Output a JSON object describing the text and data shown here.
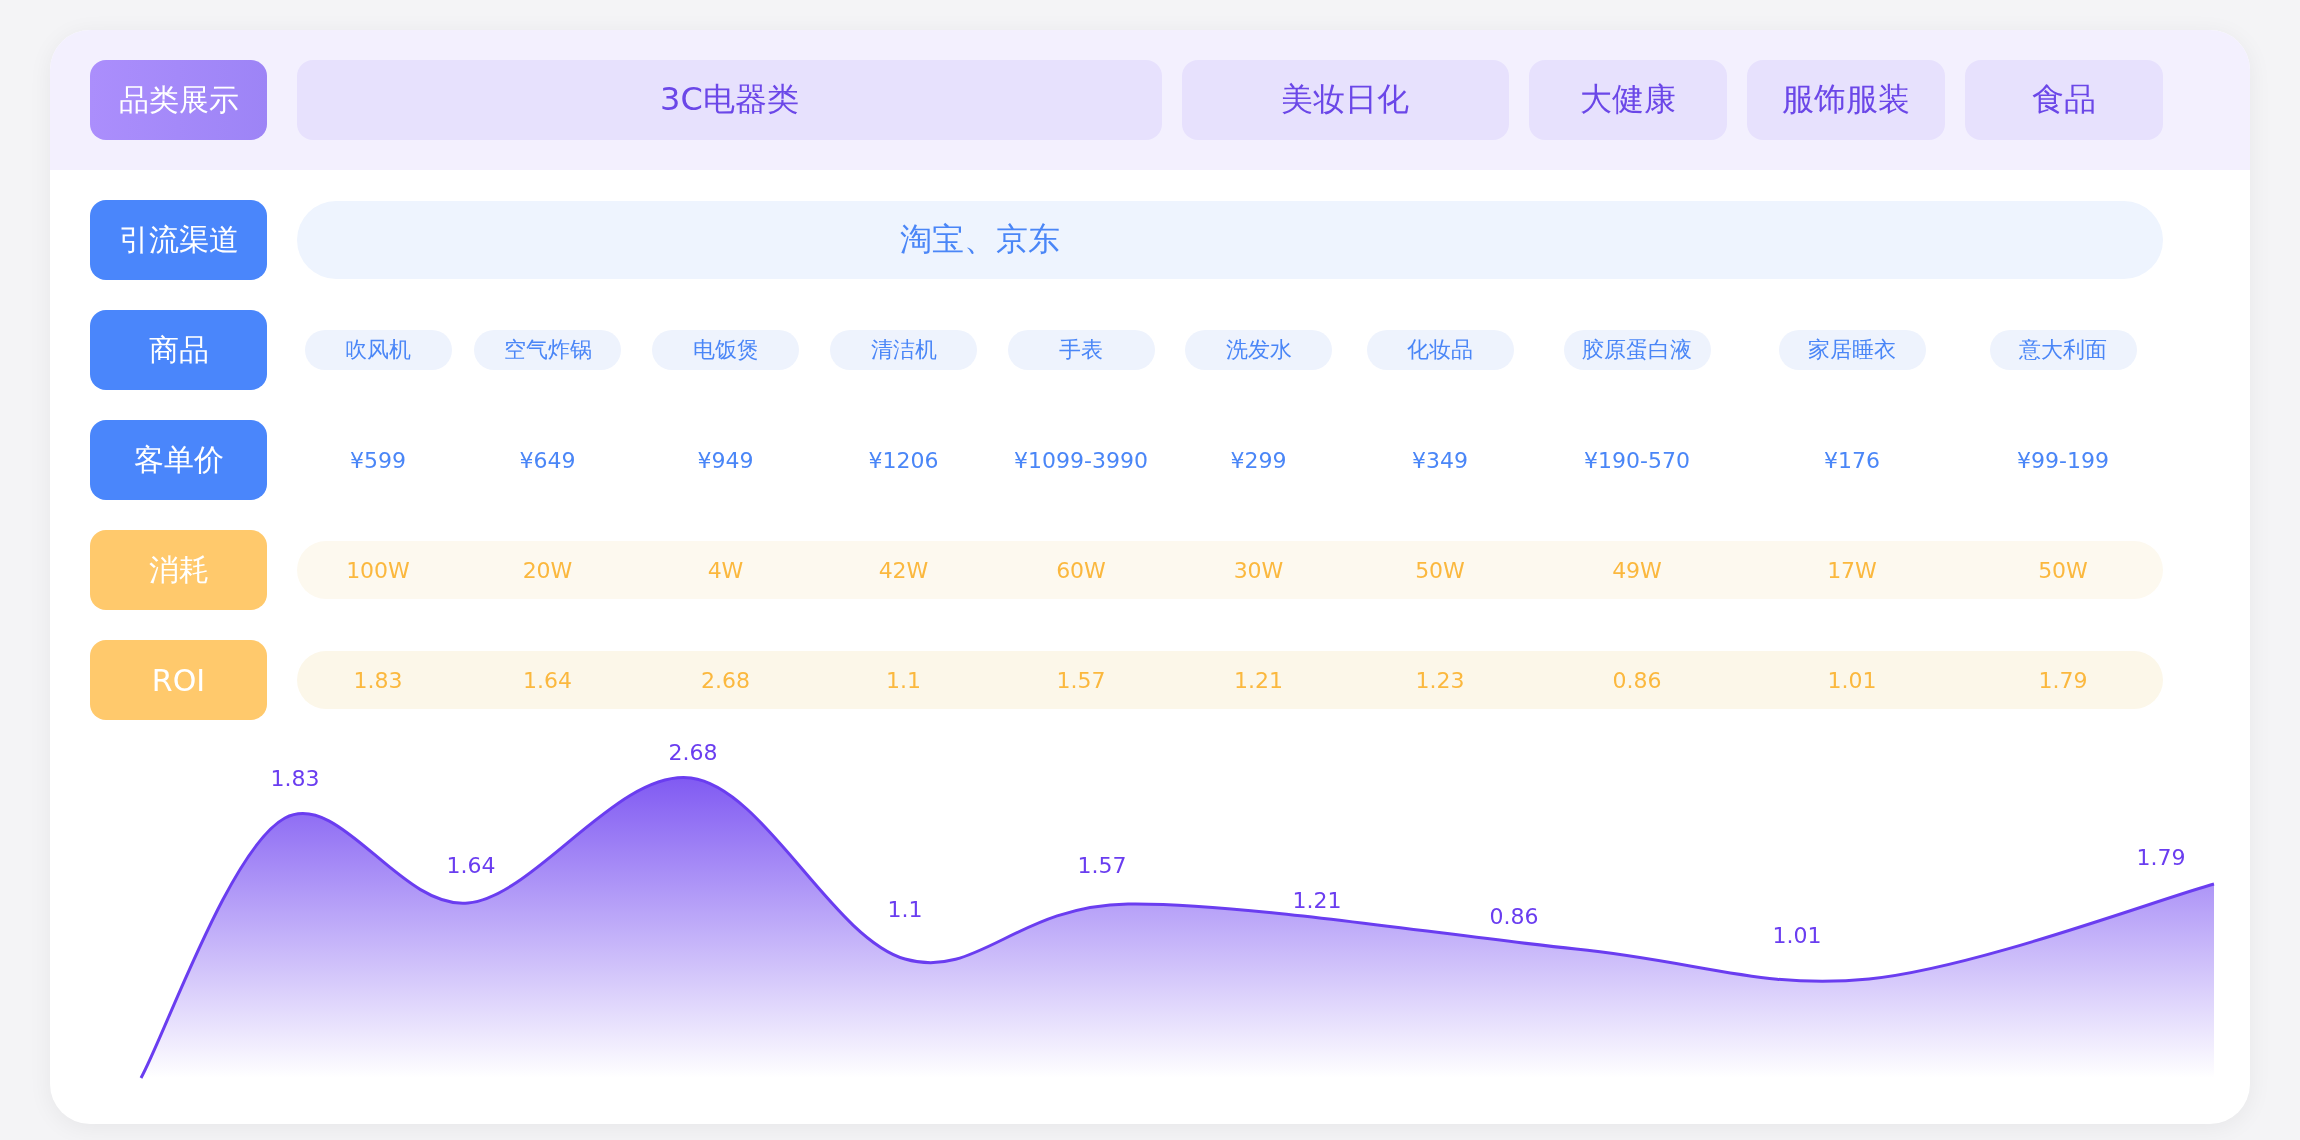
{
  "rows": [
    {
      "kind": "category",
      "label": "品类展示",
      "items": [
        "3C电器类",
        "美妆日化",
        "大健康",
        "服饰服装",
        "食品"
      ]
    },
    {
      "kind": "channel",
      "label": "引流渠道",
      "value": "淘宝、京东"
    },
    {
      "kind": "products",
      "label": "商品",
      "items": [
        "吹风机",
        "空气炸锅",
        "电饭煲",
        "清洁机",
        "手表",
        "洗发水",
        "化妆品",
        "胶原蛋白液",
        "家居睡衣",
        "意大利面"
      ]
    },
    {
      "kind": "price",
      "label": "客单价",
      "items": [
        "¥599",
        "¥649",
        "¥949",
        "¥1206",
        "¥1099-3990",
        "¥299",
        "¥349",
        "¥190-570",
        "¥176",
        "¥99-199"
      ]
    },
    {
      "kind": "consumption",
      "label": "消耗",
      "items": [
        "100W",
        "20W",
        "4W",
        "42W",
        "60W",
        "30W",
        "50W",
        "49W",
        "17W",
        "50W"
      ]
    },
    {
      "kind": "roi",
      "label": "ROI",
      "items": [
        "1.83",
        "1.64",
        "2.68",
        "1.1",
        "1.57",
        "1.21",
        "1.23",
        "0.86",
        "1.01",
        "1.79"
      ]
    }
  ],
  "chart": {
    "point_labels": [
      "1.83",
      "1.64",
      "2.68",
      "1.1",
      "1.57",
      "1.21",
      "0.86",
      "1.01",
      "1.79"
    ]
  }
}
